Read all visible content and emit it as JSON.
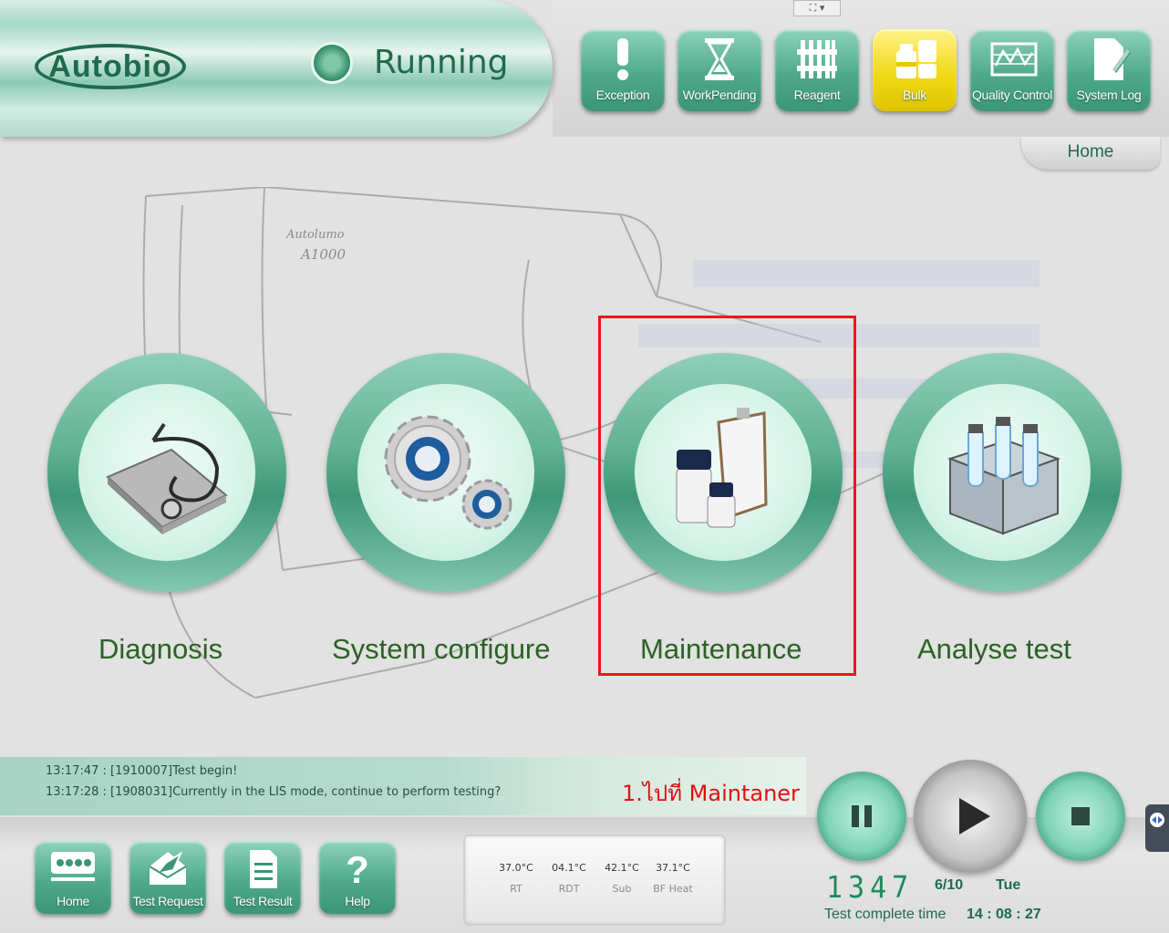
{
  "header": {
    "logo_text": "Autobio",
    "status": "Running",
    "toolbar": [
      {
        "label": "Exception",
        "icon": "exclamation-icon"
      },
      {
        "label": "WorkPending",
        "icon": "hourglass-icon"
      },
      {
        "label": "Reagent",
        "icon": "reagent-rack-icon"
      },
      {
        "label": "Bulk",
        "icon": "bulk-bottles-icon",
        "active": true
      },
      {
        "label": "Quality Control",
        "icon": "qc-chart-icon"
      },
      {
        "label": "System Log",
        "icon": "log-document-icon"
      }
    ],
    "breadcrumb": "Home"
  },
  "sketch": {
    "brand": "Autolumo",
    "model": "A1000"
  },
  "main": {
    "modules": [
      {
        "label": "Diagnosis",
        "icon": "stethoscope-icon"
      },
      {
        "label": "System configure",
        "icon": "gears-icon"
      },
      {
        "label": "Maintenance",
        "icon": "bottles-clipboard-icon"
      },
      {
        "label": "Analyse test",
        "icon": "test-tube-rack-icon"
      }
    ],
    "annotation": "1.ไปที่ Maintaner"
  },
  "log": {
    "lines": [
      "13:17:47 : [1910007]Test begin!",
      "13:17:28 : [1908031]Currently in the LIS mode, continue to perform testing?"
    ]
  },
  "bottom_nav": [
    {
      "label": "Home",
      "icon": "home-dots-icon"
    },
    {
      "label": "Test Request",
      "icon": "envelope-icon"
    },
    {
      "label": "Test Result",
      "icon": "document-icon"
    },
    {
      "label": "Help",
      "icon": "question-icon"
    }
  ],
  "temperatures": [
    {
      "value": "37.0°C",
      "name": "RT"
    },
    {
      "value": "04.1°C",
      "name": "RDT"
    },
    {
      "value": "42.1°C",
      "name": "Sub"
    },
    {
      "value": "37.1°C",
      "name": "BF Heat"
    }
  ],
  "status": {
    "counter": "1347",
    "date": "6/10",
    "day": "Tue",
    "complete_label": "Test complete time",
    "complete_time": "14 : 08 : 27"
  },
  "colors": {
    "accent": "#4faa8a",
    "dark_green": "#1f6b4e",
    "highlight": "#e51a1a",
    "bulk_active": "#f1d917"
  }
}
